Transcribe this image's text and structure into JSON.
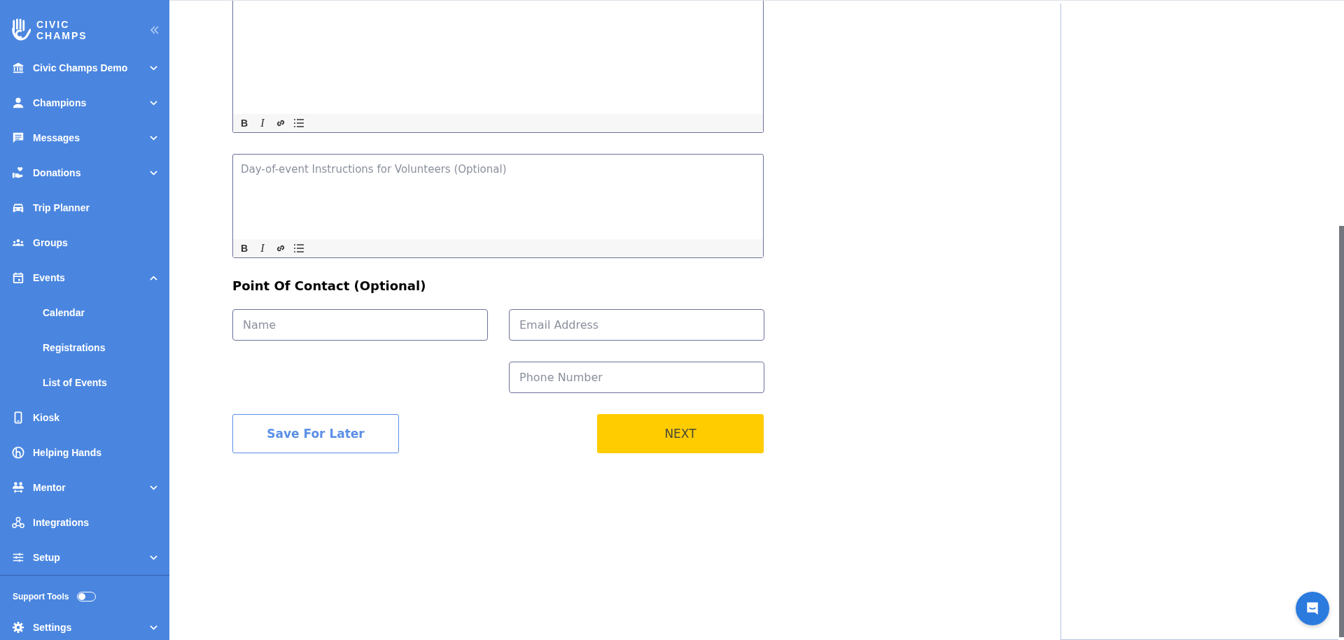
{
  "sidebar": {
    "logo_lines": [
      "CIVIC",
      "CHAMPS"
    ],
    "items": [
      {
        "kind": "group",
        "label": "Civic Champs Demo",
        "expanded": false
      },
      {
        "kind": "group",
        "label": "Champions",
        "expanded": false
      },
      {
        "kind": "group",
        "label": "Messages",
        "expanded": false
      },
      {
        "kind": "group",
        "label": "Donations",
        "expanded": false
      },
      {
        "kind": "link",
        "label": "Trip Planner"
      },
      {
        "kind": "link",
        "label": "Groups"
      },
      {
        "kind": "group",
        "label": "Events",
        "expanded": true
      },
      {
        "kind": "sub",
        "label": "Calendar"
      },
      {
        "kind": "sub",
        "label": "Registrations"
      },
      {
        "kind": "sub",
        "label": "List of Events"
      },
      {
        "kind": "link",
        "label": "Kiosk"
      },
      {
        "kind": "link",
        "label": "Helping Hands"
      },
      {
        "kind": "group",
        "label": "Mentor",
        "expanded": false
      },
      {
        "kind": "link",
        "label": "Integrations"
      },
      {
        "kind": "group",
        "label": "Setup",
        "expanded": false
      }
    ],
    "support_tools": {
      "label": "Support Tools",
      "on": false
    },
    "settings": {
      "label": "Settings",
      "expanded": false
    }
  },
  "editors": [
    {
      "toolbar": [
        {
          "kind": "bold",
          "text": "B"
        },
        {
          "kind": "italic",
          "text": "I"
        },
        {
          "kind": "link"
        },
        {
          "kind": "list"
        }
      ]
    },
    {
      "placeholder": "Day-of-event Instructions for Volunteers (Optional)",
      "toolbar": [
        {
          "kind": "bold",
          "text": "B"
        },
        {
          "kind": "italic",
          "text": "I"
        },
        {
          "kind": "link"
        },
        {
          "kind": "list"
        }
      ]
    }
  ],
  "contact": {
    "heading": "Point Of Contact (Optional)",
    "fields": [
      {
        "placeholder": "Name"
      },
      {
        "placeholder": "Email Address"
      },
      {
        "placeholder": "Phone Number"
      }
    ]
  },
  "buttons": {
    "save": "Save For Later",
    "next": "NEXT"
  }
}
